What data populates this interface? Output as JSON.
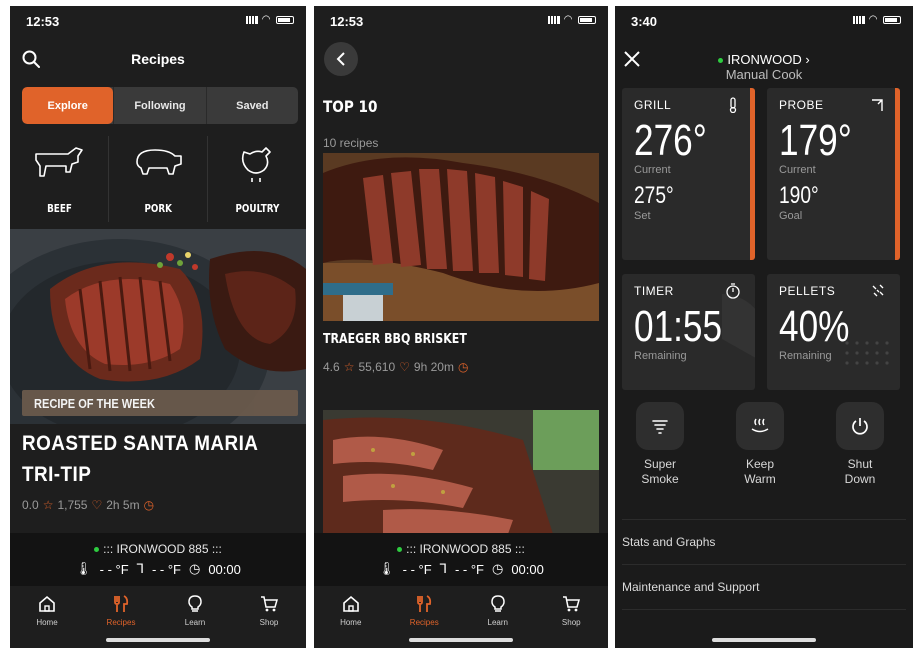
{
  "colors": {
    "accent": "#e0632a",
    "background": "#1e1e1e",
    "online": "#2ecc40"
  },
  "screen1": {
    "status_time": "12:53",
    "title": "Recipes",
    "tabs": [
      "Explore",
      "Following",
      "Saved"
    ],
    "active_tab": "Explore",
    "categories": [
      "BEEF",
      "PORK",
      "POULTRY"
    ],
    "badge": "RECIPE OF THE WEEK",
    "recipe_title_line1": "ROASTED SANTA MARIA",
    "recipe_title_line2": "TRI-TIP",
    "rating": "0.0",
    "saves": "1,755",
    "time": "2h 5m"
  },
  "device": {
    "name": "::: IRONWOOD 885 :::",
    "grill_temp": "- - °F",
    "probe_temp": "- - °F",
    "timer": "00:00"
  },
  "nav": [
    "Home",
    "Recipes",
    "Learn",
    "Shop"
  ],
  "nav_active": "Recipes",
  "screen2": {
    "status_time": "12:53",
    "title": "TOP 10",
    "count": "10 recipes",
    "recipe1_title": "TRAEGER BBQ BRISKET",
    "recipe1_rating": "4.6",
    "recipe1_saves": "55,610",
    "recipe1_time": "9h 20m"
  },
  "screen3": {
    "status_time": "3:40",
    "grill_name": "IRONWOOD",
    "mode": "Manual Cook",
    "grill": {
      "label": "GRILL",
      "current": "276°",
      "current_label": "Current",
      "set": "275°",
      "set_label": "Set"
    },
    "probe": {
      "label": "PROBE",
      "current": "179°",
      "current_label": "Current",
      "goal": "190°",
      "goal_label": "Goal"
    },
    "timer": {
      "label": "TIMER",
      "value": "01:55",
      "sub": "Remaining"
    },
    "pellets": {
      "label": "PELLETS",
      "value": "40%",
      "sub": "Remaining"
    },
    "actions": [
      {
        "line1": "Super",
        "line2": "Smoke"
      },
      {
        "line1": "Keep",
        "line2": "Warm"
      },
      {
        "line1": "Shut",
        "line2": "Down"
      }
    ],
    "menu": [
      "Stats and Graphs",
      "Maintenance and Support"
    ]
  }
}
